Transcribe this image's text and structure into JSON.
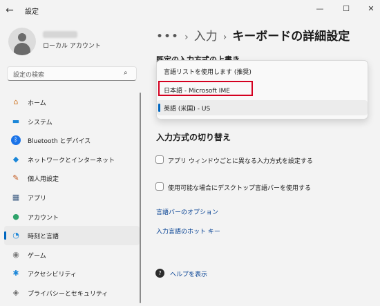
{
  "window": {
    "title": "設定",
    "back_glyph": "←",
    "minimize_glyph": "—",
    "maximize_glyph": "☐",
    "close_glyph": "✕"
  },
  "user": {
    "name": "●●●● ●●●",
    "account_type": "ローカル アカウント"
  },
  "search": {
    "placeholder": "設定の検索",
    "icon": "search-icon",
    "glyph": "⌕"
  },
  "sidebar": {
    "items": [
      {
        "label": "ホーム",
        "icon": "home-icon",
        "glyph": "⌂",
        "color": "#d07a2c"
      },
      {
        "label": "システム",
        "icon": "monitor-icon",
        "glyph": "▬",
        "color": "#1a86d8"
      },
      {
        "label": "Bluetooth とデバイス",
        "icon": "bluetooth-icon",
        "glyph": "ᛒ",
        "color": "#ffffff",
        "bg": "#1a73e8"
      },
      {
        "label": "ネットワークとインターネット",
        "icon": "wifi-icon",
        "glyph": "◆",
        "color": "#1a86d8"
      },
      {
        "label": "個人用設定",
        "icon": "brush-icon",
        "glyph": "✎",
        "color": "#c2571a"
      },
      {
        "label": "アプリ",
        "icon": "apps-icon",
        "glyph": "▦",
        "color": "#3a5a80"
      },
      {
        "label": "アカウント",
        "icon": "person-icon",
        "glyph": "●",
        "color": "#2fa36b"
      },
      {
        "label": "時刻と言語",
        "icon": "globe-clock-icon",
        "glyph": "◔",
        "color": "#1a86d8",
        "active": true
      },
      {
        "label": "ゲーム",
        "icon": "gamepad-icon",
        "glyph": "◉",
        "color": "#7b7b7b"
      },
      {
        "label": "アクセシビリティ",
        "icon": "accessibility-icon",
        "glyph": "✱",
        "color": "#1a86d8"
      },
      {
        "label": "プライバシーとセキュリティ",
        "icon": "shield-icon",
        "glyph": "◈",
        "color": "#6b6b6b"
      }
    ]
  },
  "breadcrumb": {
    "more": "•••",
    "separator": "›",
    "parent": "入力",
    "current": "キーボードの詳細設定"
  },
  "override_heading": "既定の入力方式の上書き",
  "dropdown": {
    "options": [
      {
        "label": "言語リストを使用します (推奨)"
      },
      {
        "label": "日本語 - Microsoft IME"
      },
      {
        "label": "英語 (米国) - US",
        "selected": true
      }
    ]
  },
  "switching": {
    "title": "入力方式の切り替え",
    "checkbox1": "アプリ ウィンドウごとに異なる入力方式を設定する",
    "checkbox2": "使用可能な場合にデスクトップ言語バーを使用する",
    "link1": "言語バーのオプション",
    "link2": "入力言語のホット キー"
  },
  "help": {
    "label": "ヘルプを表示",
    "glyph": "?"
  },
  "colors": {
    "accent": "#0067c0",
    "highlight": "#d40020",
    "link": "#003e92"
  }
}
